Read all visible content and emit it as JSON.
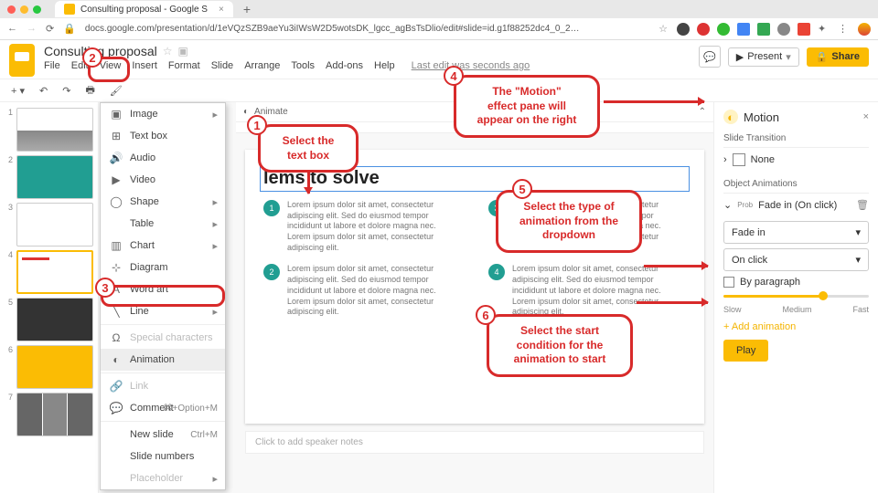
{
  "titlebar": {
    "tab": "Consulting proposal - Google S"
  },
  "url": "docs.google.com/presentation/d/1eVQzSZB9aeYu3iIWsW2D5wotsDK_lgcc_agBsTsDlio/edit#slide=id.g1f88252dc4_0_2…",
  "doc": {
    "name": "Consulting proposal",
    "menu": [
      "File",
      "Edit",
      "View",
      "Insert",
      "Format",
      "Slide",
      "Arrange",
      "Tools",
      "Add-ons",
      "Help"
    ],
    "lastEdit": "Last edit was seconds ago",
    "present": "Present",
    "share": "Share"
  },
  "toolbar": {
    "animate": "Animate"
  },
  "insertMenu": {
    "items": [
      {
        "icon": "▣",
        "label": "Image",
        "sub": true
      },
      {
        "icon": "⊞",
        "label": "Text box"
      },
      {
        "icon": "🔊",
        "label": "Audio"
      },
      {
        "icon": "▶",
        "label": "Video"
      },
      {
        "icon": "◯",
        "label": "Shape",
        "sub": true
      },
      {
        "icon": "",
        "label": "Table",
        "sub": true
      },
      {
        "icon": "▥",
        "label": "Chart",
        "sub": true
      },
      {
        "icon": "⊹",
        "label": "Diagram"
      },
      {
        "icon": "A",
        "label": "Word art"
      },
      {
        "icon": "╲",
        "label": "Line",
        "sub": true
      }
    ],
    "special": "Special characters",
    "animation": "Animation",
    "link": "Link",
    "comment": "Comment",
    "commentKey": "⌘+Option+M",
    "newSlide": "New slide",
    "newSlideKey": "Ctrl+M",
    "slideNumbers": "Slide numbers",
    "placeholder": "Placeholder"
  },
  "slide": {
    "title": "lems to solve",
    "lorem": "Lorem ipsum dolor sit amet, consectetur adipiscing elit. Sed do eiusmod tempor incididunt ut labore et dolore magna nec. Lorem ipsum dolor sit amet, consectetur adipiscing elit.",
    "loremShort": "Lorem ipsum dolor sit amet, consectetur adipiscing elit. Sed do eiusmod tempor incididunt ut labore et dolore magna nec. Lorem ipsum dolor sit amet, consectetur adipiscing elit.",
    "speaker": "Click to add speaker notes"
  },
  "motion": {
    "title": "Motion",
    "slideTransition": "Slide Transition",
    "none": "None",
    "objectAnimations": "Object Animations",
    "prob": "Prob",
    "current": "Fade in  (On click)",
    "typeDropdown": "Fade in",
    "startDropdown": "On click",
    "byParagraph": "By paragraph",
    "slow": "Slow",
    "medium": "Medium",
    "fast": "Fast",
    "addAnimation": "Add animation",
    "play": "Play"
  },
  "callouts": {
    "c1": "Select the text box",
    "c4a": "The \"Motion\"",
    "c4b": "effect pane will",
    "c4c": "appear on the right",
    "c5a": "Select the type of",
    "c5b": "animation from the",
    "c5c": "dropdown",
    "c6a": "Select the start",
    "c6b": "condition for the",
    "c6c": "animation to start"
  }
}
